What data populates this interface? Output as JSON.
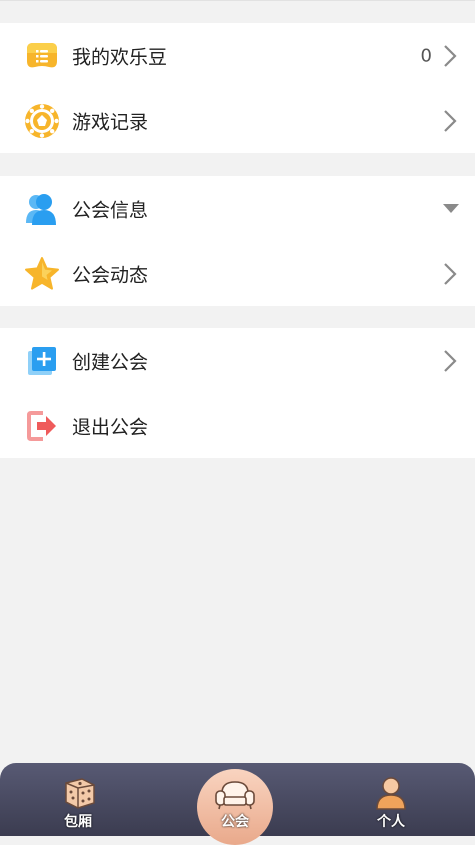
{
  "groups": [
    {
      "rows": [
        {
          "label": "我的欢乐豆",
          "value": "0",
          "icon": "beans-icon",
          "trailing": "chevron"
        },
        {
          "label": "游戏记录",
          "icon": "game-record-icon",
          "trailing": "chevron"
        }
      ]
    },
    {
      "rows": [
        {
          "label": "公会信息",
          "icon": "guild-members-icon",
          "trailing": "caret"
        },
        {
          "label": "公会动态",
          "icon": "star-icon",
          "trailing": "chevron"
        }
      ]
    },
    {
      "rows": [
        {
          "label": "创建公会",
          "icon": "create-plus-icon",
          "trailing": "chevron"
        },
        {
          "label": "退出公会",
          "icon": "exit-icon",
          "trailing": "none"
        }
      ]
    }
  ],
  "tabbar": {
    "tabs": [
      {
        "label": "包厢",
        "icon": "dice-icon"
      },
      {
        "label": "公会",
        "icon": "sofa-icon",
        "active": true
      },
      {
        "label": "个人",
        "icon": "person-icon"
      }
    ]
  },
  "colors": {
    "background": "#f2f2f2",
    "tabbar": "#4a4b62",
    "active_tab": "#efb89c",
    "icon_yellow": "#f7b52b",
    "icon_blue": "#2a9ef0",
    "icon_red": "#ef5b5b"
  }
}
